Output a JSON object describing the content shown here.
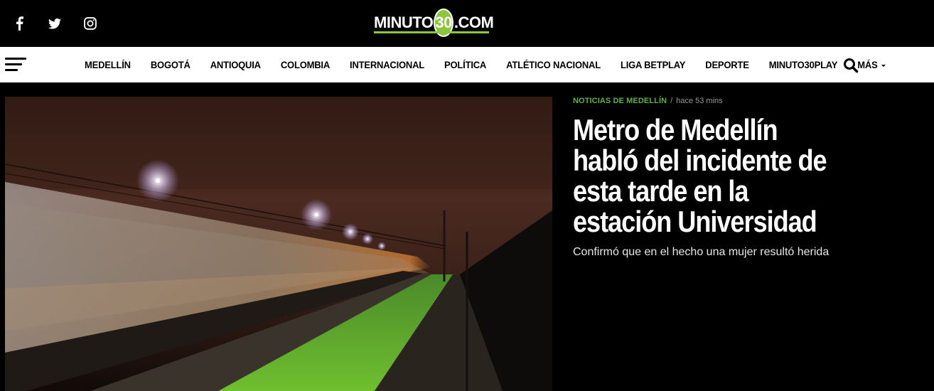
{
  "header": {
    "social": [
      {
        "name": "facebook-icon"
      },
      {
        "name": "twitter-icon"
      },
      {
        "name": "instagram-icon"
      }
    ],
    "logo": {
      "part1": "MINUTO",
      "number": "30",
      "part2": ".COM"
    }
  },
  "nav": {
    "items": [
      "MEDELLÍN",
      "BOGOTÁ",
      "ANTIOQUIA",
      "COLOMBIA",
      "INTERNACIONAL",
      "POLÍTICA",
      "ATLÉTICO NACIONAL",
      "LIGA BETPLAY",
      "DEPORTE",
      "MINUTO30PLAY"
    ],
    "more_label": "MÁS"
  },
  "featured": {
    "category": "NOTICIAS DE MEDELLÍN",
    "separator": "/",
    "time": "hace 53 mins",
    "title": "Metro de Medellín habló del incidente de esta tarde en la estación Universidad",
    "excerpt": "Confirmó que en el hecho una mujer resultó herida"
  },
  "colors": {
    "accent": "#5fb043",
    "logo_green": "#8cc63f",
    "background": "#000000",
    "navbar": "#ffffff"
  }
}
